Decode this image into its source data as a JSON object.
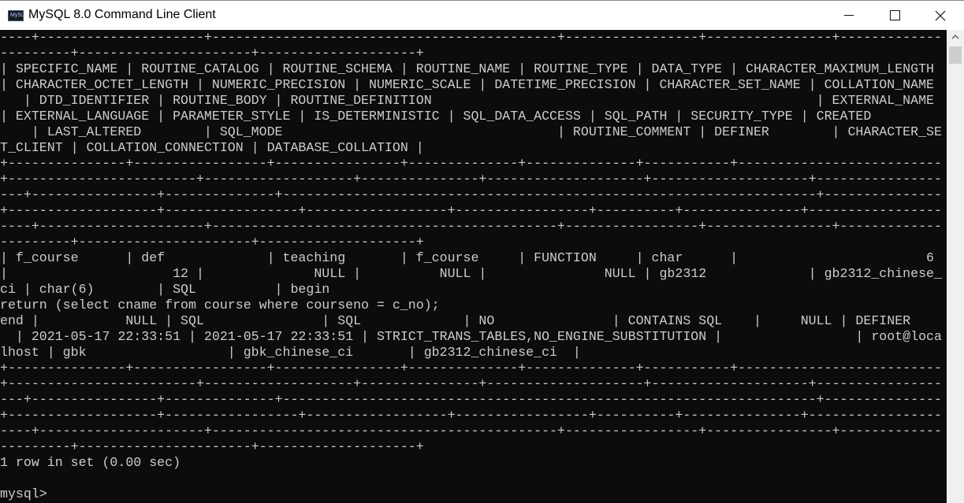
{
  "window": {
    "title": "MySQL 8.0 Command Line Client",
    "icon_label": "My5L",
    "controls": [
      "minimize",
      "maximize",
      "close"
    ]
  },
  "console": {
    "background": "#0c0c0c",
    "foreground": "#cccccc",
    "lines": [
      "----+---------------------+--------------------------------------------+-----------------+----------------+-------------",
      "---------+----------------------+--------------------+",
      "| SPECIFIC_NAME | ROUTINE_CATALOG | ROUTINE_SCHEMA | ROUTINE_NAME | ROUTINE_TYPE | DATA_TYPE | CHARACTER_MAXIMUM_LENGTH ",
      "| CHARACTER_OCTET_LENGTH | NUMERIC_PRECISION | NUMERIC_SCALE | DATETIME_PRECISION | CHARACTER_SET_NAME | COLLATION_NAME ",
      "   | DTD_IDENTIFIER | ROUTINE_BODY | ROUTINE_DEFINITION                                                 | EXTERNAL_NAME ",
      "| EXTERNAL_LANGUAGE | PARAMETER_STYLE | IS_DETERMINISTIC | SQL_DATA_ACCESS | SQL_PATH | SECURITY_TYPE | CREATED         ",
      "    | LAST_ALTERED        | SQL_MODE                                   | ROUTINE_COMMENT | DEFINER        | CHARACTER_SE",
      "T_CLIENT | COLLATION_CONNECTION | DATABASE_COLLATION |",
      "+---------------+-----------------+----------------+--------------+--------------+-----------+--------------------------",
      "+------------------------+-------------------+---------------+--------------------+--------------------+----------------",
      "---+----------------+--------------+--------------------------------------------------------------------+---------------",
      "+-------------------+-----------------+------------------+-----------------+----------+---------------+-----------------",
      "----+---------------------+--------------------------------------------+-----------------+----------------+-------------",
      "---------+----------------------+--------------------+",
      "| f_course      | def             | teaching       | f_course     | FUNCTION     | char      |                        6 ",
      "|                     12 |              NULL |          NULL |               NULL | gb2312             | gb2312_chinese_",
      "ci | char(6)        | SQL          | begin",
      "return (select cname from course where courseno = c_no);",
      "end |           NULL | SQL               | SQL             | NO               | CONTAINS SQL    |     NULL | DEFINER      ",
      "  | 2021-05-17 22:33:51 | 2021-05-17 22:33:51 | STRICT_TRANS_TABLES,NO_ENGINE_SUBSTITUTION |                 | root@loca",
      "lhost | gbk                  | gbk_chinese_ci       | gb2312_chinese_ci  |",
      "+---------------+-----------------+----------------+--------------+--------------+-----------+--------------------------",
      "+------------------------+-------------------+---------------+--------------------+--------------------+----------------",
      "---+----------------+--------------+--------------------------------------------------------------------+---------------",
      "+-------------------+-----------------+------------------+-----------------+----------+---------------+-----------------",
      "----+---------------------+--------------------------------------------+-----------------+----------------+-------------",
      "---------+----------------------+--------------------+",
      "1 row in set (0.00 sec)",
      "",
      "mysql>"
    ]
  },
  "result": {
    "summary": "1 row in set (0.00 sec)",
    "prompt": "mysql>",
    "columns": [
      "SPECIFIC_NAME",
      "ROUTINE_CATALOG",
      "ROUTINE_SCHEMA",
      "ROUTINE_NAME",
      "ROUTINE_TYPE",
      "DATA_TYPE",
      "CHARACTER_MAXIMUM_LENGTH",
      "CHARACTER_OCTET_LENGTH",
      "NUMERIC_PRECISION",
      "NUMERIC_SCALE",
      "DATETIME_PRECISION",
      "CHARACTER_SET_NAME",
      "COLLATION_NAME",
      "DTD_IDENTIFIER",
      "ROUTINE_BODY",
      "ROUTINE_DEFINITION",
      "EXTERNAL_NAME",
      "EXTERNAL_LANGUAGE",
      "PARAMETER_STYLE",
      "IS_DETERMINISTIC",
      "SQL_DATA_ACCESS",
      "SQL_PATH",
      "SECURITY_TYPE",
      "CREATED",
      "LAST_ALTERED",
      "SQL_MODE",
      "ROUTINE_COMMENT",
      "DEFINER",
      "CHARACTER_SET_CLIENT",
      "COLLATION_CONNECTION",
      "DATABASE_COLLATION"
    ],
    "row": [
      "f_course",
      "def",
      "teaching",
      "f_course",
      "FUNCTION",
      "char",
      "6",
      "12",
      "NULL",
      "NULL",
      "NULL",
      "gb2312",
      "gb2312_chinese_ci",
      "char(6)",
      "SQL",
      "begin\nreturn (select cname from course where courseno = c_no);\nend",
      "NULL",
      "SQL",
      "SQL",
      "NO",
      "CONTAINS SQL",
      "NULL",
      "DEFINER",
      "2021-05-17 22:33:51",
      "2021-05-17 22:33:51",
      "STRICT_TRANS_TABLES,NO_ENGINE_SUBSTITUTION",
      "",
      "root@localhost",
      "gbk",
      "gbk_chinese_ci",
      "gb2312_chinese_ci"
    ]
  },
  "scrollbar": {
    "up_arrow_icon": "chevron-up-icon"
  }
}
